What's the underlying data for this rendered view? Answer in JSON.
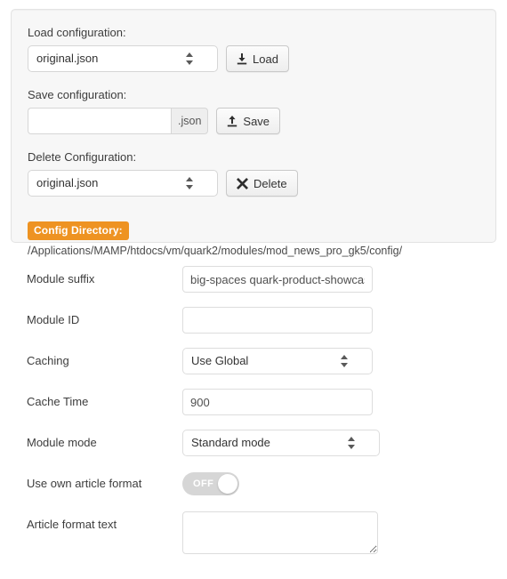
{
  "config_panel": {
    "load": {
      "label": "Load configuration:",
      "selected": "original.json",
      "button_label": "Load",
      "button_icon": "download-icon"
    },
    "save": {
      "label": "Save configuration:",
      "value": "",
      "placeholder": "",
      "suffix": ".json",
      "button_label": "Save",
      "button_icon": "upload-icon"
    },
    "delete": {
      "label": "Delete Configuration:",
      "selected": "original.json",
      "button_label": "Delete",
      "button_icon": "close-x-icon"
    },
    "directory": {
      "badge_label": "Config Directory:",
      "badge_color": "#ee9322",
      "path": "/Applications/MAMP/htdocs/vm/quark2/modules/mod_news_pro_gk5/config/"
    }
  },
  "form": {
    "rows": [
      {
        "label": "Module suffix",
        "type": "text",
        "value": "big-spaces quark-product-showcase"
      },
      {
        "label": "Module ID",
        "type": "text",
        "value": ""
      },
      {
        "label": "Caching",
        "type": "select",
        "value": "Use Global"
      },
      {
        "label": "Cache Time",
        "type": "text",
        "value": "900"
      },
      {
        "label": "Module mode",
        "type": "select",
        "value": "Standard mode"
      },
      {
        "label": "Use own article format",
        "type": "toggle",
        "value": "OFF"
      },
      {
        "label": "Article format text",
        "type": "textarea",
        "value": ""
      }
    ]
  }
}
